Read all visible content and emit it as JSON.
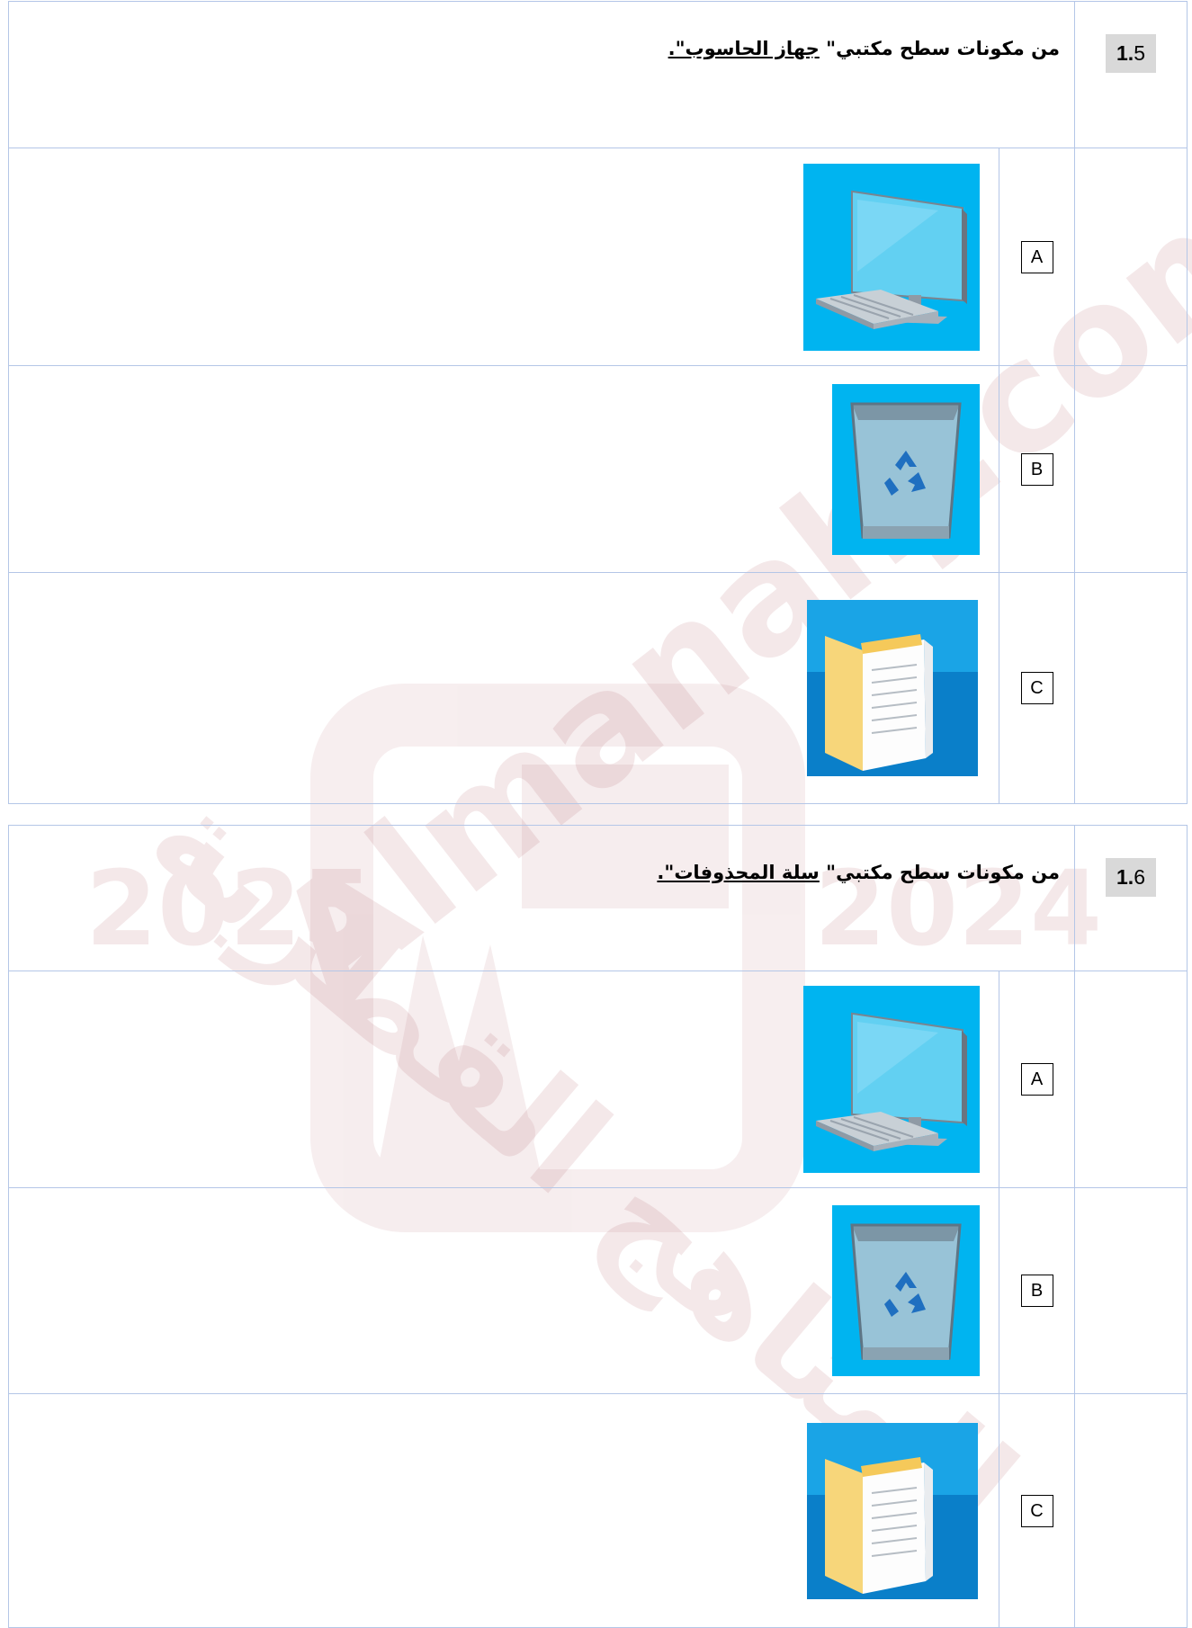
{
  "watermark": {
    "main": "Almanahj.com",
    "year_left": "2025",
    "year_right": "2024",
    "arabic": "المناهج القطرية"
  },
  "questions": [
    {
      "number_bold": "1.",
      "number_rest": "5",
      "prompt": "من مكونات سطح مكتبي\"",
      "prompt_underlined": "جهاز الحاسوب\".",
      "options": [
        {
          "letter": "A",
          "icon": "this-pc-icon"
        },
        {
          "letter": "B",
          "icon": "recycle-bin-icon"
        },
        {
          "letter": "C",
          "icon": "documents-folder-icon"
        }
      ]
    },
    {
      "number_bold": "1.",
      "number_rest": "6",
      "prompt": "من مكونات سطح مكتبي\"",
      "prompt_underlined": "سلة المحذوفات\".",
      "options": [
        {
          "letter": "A",
          "icon": "this-pc-icon"
        },
        {
          "letter": "B",
          "icon": "recycle-bin-icon"
        },
        {
          "letter": "C",
          "icon": "documents-folder-icon"
        }
      ]
    }
  ],
  "colors": {
    "border": "#b4c6e7",
    "icon_bg": "#00b4f0",
    "number_bg": "#d9d9d9"
  }
}
